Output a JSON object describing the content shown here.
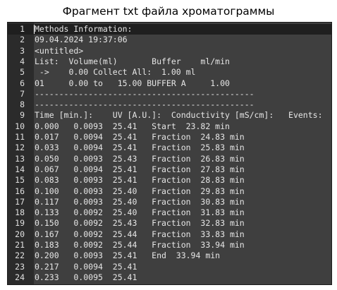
{
  "title": "Фрагмент txt файла хроматограммы",
  "colors": {
    "editor_background": "#3f3f3f",
    "gutter_background": "#2b2b2b",
    "current_line": "#1f1f1f",
    "text": "#e6e6e6"
  },
  "lines": [
    {
      "num": "1",
      "text": "Methods Information:"
    },
    {
      "num": "2",
      "text": "09.04.2024 19:37:06"
    },
    {
      "num": "3",
      "text": "<untitled>"
    },
    {
      "num": "4",
      "text": "List:  Volume(ml)       Buffer    ml/min"
    },
    {
      "num": "5",
      "text": " ->    0.00 Collect All:  1.00 ml"
    },
    {
      "num": "6",
      "text": "01     0.00 to   15.00 BUFFER A     1.00"
    },
    {
      "num": "7",
      "text": "---------------------------------------------"
    },
    {
      "num": "8",
      "text": "---------------------------------------------"
    },
    {
      "num": "9",
      "text": "Time [min.]:    UV [A.U.]:  Conductivity [mS/cm]:   Events:"
    },
    {
      "num": "10",
      "text": "0.000   0.0093  25.41   Start  23.82 min"
    },
    {
      "num": "11",
      "text": "0.017   0.0094  25.41   Fraction  24.83 min"
    },
    {
      "num": "12",
      "text": "0.033   0.0094  25.41   Fraction  25.83 min"
    },
    {
      "num": "13",
      "text": "0.050   0.0093  25.43   Fraction  26.83 min"
    },
    {
      "num": "14",
      "text": "0.067   0.0094  25.41   Fraction  27.83 min"
    },
    {
      "num": "15",
      "text": "0.083   0.0093  25.41   Fraction  28.83 min"
    },
    {
      "num": "16",
      "text": "0.100   0.0093  25.40   Fraction  29.83 min"
    },
    {
      "num": "17",
      "text": "0.117   0.0093  25.40   Fraction  30.83 min"
    },
    {
      "num": "18",
      "text": "0.133   0.0092  25.40   Fraction  31.83 min"
    },
    {
      "num": "19",
      "text": "0.150   0.0092  25.43   Fraction  32.83 min"
    },
    {
      "num": "20",
      "text": "0.167   0.0092  25.44   Fraction  33.83 min"
    },
    {
      "num": "21",
      "text": "0.183   0.0092  25.44   Fraction  33.94 min"
    },
    {
      "num": "22",
      "text": "0.200   0.0093  25.41   End  33.94 min"
    },
    {
      "num": "23",
      "text": "0.217   0.0094  25.41"
    },
    {
      "num": "24",
      "text": "0.233   0.0095  25.41"
    }
  ]
}
